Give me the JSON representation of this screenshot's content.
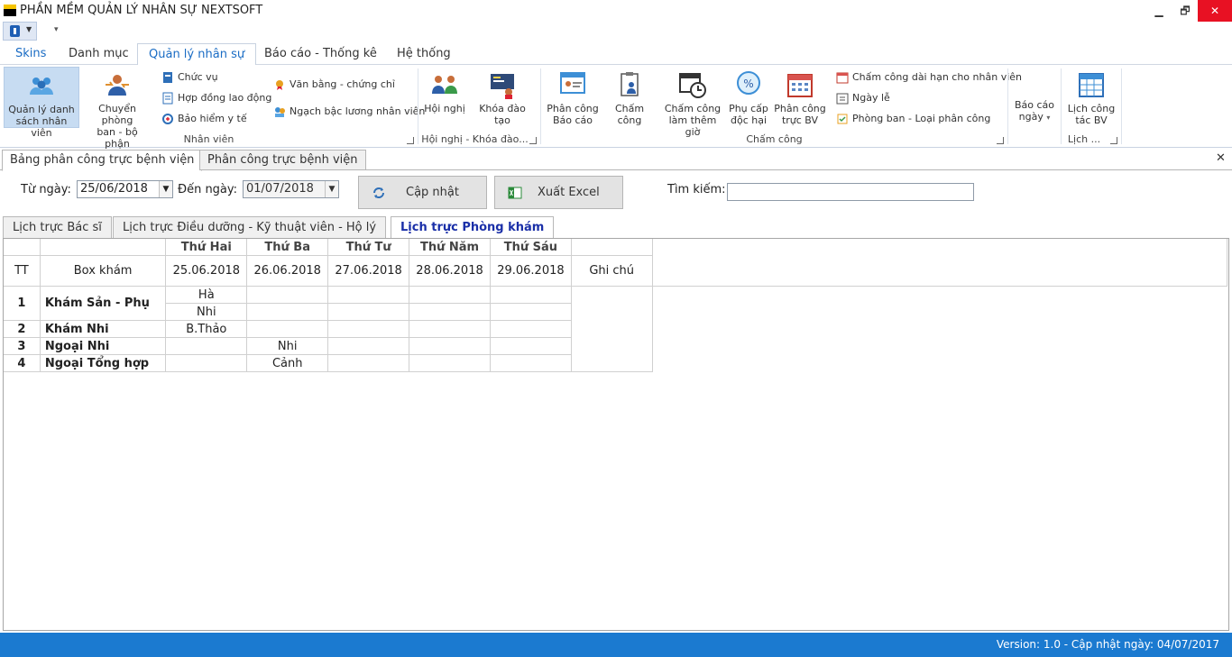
{
  "window": {
    "title": "PHẦN MỀM QUẢN LÝ NHÂN SỰ NEXTSOFT",
    "min": "▁",
    "max": "🗗",
    "close": "✕"
  },
  "ribbon_tabs": [
    "Skins",
    "Danh mục",
    "Quản lý nhân sự",
    "Báo cáo - Thống kê",
    "Hệ thống"
  ],
  "active_tab": "Quản lý nhân sự",
  "ribbon": {
    "nhanvien": {
      "label": "Nhân viên",
      "b_quanly": [
        "Quản lý danh",
        "sách nhân viên"
      ],
      "b_chuyen": [
        "Chuyển phòng",
        "ban - bộ phận"
      ],
      "s_chucvu": "Chức vụ",
      "s_hopdong": "Hợp đồng lao động",
      "s_baohiem": "Bảo hiểm y tế",
      "s_vanbang": "Văn bằng - chứng chỉ",
      "s_ngach": "Ngạch bậc lương nhân viên"
    },
    "hoinghi": {
      "label": "Hội nghị - Khóa đào...",
      "b_hoinghi": "Hội nghị",
      "b_khoa": "Khóa đào tạo"
    },
    "chamcong": {
      "label": "Chấm công",
      "b_phancong": [
        "Phân công",
        "Báo cáo"
      ],
      "b_chamcong": "Chấm công",
      "b_themgio": [
        "Chấm công",
        "làm thêm giờ"
      ],
      "b_phucap": [
        "Phụ cấp",
        "độc hại"
      ],
      "b_truc": [
        "Phân công",
        "trực BV"
      ],
      "s_daihan": "Chấm công dài hạn cho nhân viên",
      "s_ngayle": "Ngày lễ",
      "s_phongban": "Phòng ban - Loại phân công"
    },
    "baocao": {
      "b": [
        "Báo cáo",
        "ngày"
      ],
      "arrow": "▾"
    },
    "lich": {
      "label": "Lịch ...",
      "b": [
        "Lịch công",
        "tác BV"
      ]
    }
  },
  "doc_tabs": [
    "Bảng phân công trực bệnh viện",
    "Phân công trực bệnh viện"
  ],
  "doc_close": "✕",
  "filter": {
    "from_label": "Từ ngày:",
    "from_value": "25/06/2018",
    "to_label": "Đến ngày:",
    "to_value": "01/07/2018",
    "update": "Cập nhật",
    "export": "Xuất Excel",
    "search_label": "Tìm kiếm:",
    "search_value": ""
  },
  "sub_tabs": [
    "Lịch trực Bác sĩ",
    "Lịch trực Điều dưỡng - Kỹ thuật viên - Hộ lý",
    "Lịch trực Phòng khám"
  ],
  "table": {
    "days": [
      "Thứ Hai",
      "Thứ Ba",
      "Thứ Tư",
      "Thứ Năm",
      "Thứ Sáu"
    ],
    "col_tt": "TT",
    "col_box": "Box khám",
    "dates": [
      "25.06.2018",
      "26.06.2018",
      "27.06.2018",
      "28.06.2018",
      "29.06.2018"
    ],
    "col_note": "Ghi chú",
    "rows": [
      {
        "tt": "1",
        "box": "Khám Sản - Phụ",
        "c1a": "Hà",
        "c1b": "Nhi"
      },
      {
        "tt": "2",
        "box": "Khám Nhi",
        "c1": "B.Thảo"
      },
      {
        "tt": "3",
        "box": "Ngoại Nhi",
        "c2": "Nhi"
      },
      {
        "tt": "4",
        "box": "Ngoại Tổng hợp",
        "c2": "Cảnh"
      }
    ]
  },
  "status": {
    "version": "Version: 1.0 - Cập nhật ngày: 04/07/2017"
  },
  "colors": {
    "accent": "#1a6cc4",
    "statusbar": "#1b7ad0",
    "close": "#e81123"
  }
}
